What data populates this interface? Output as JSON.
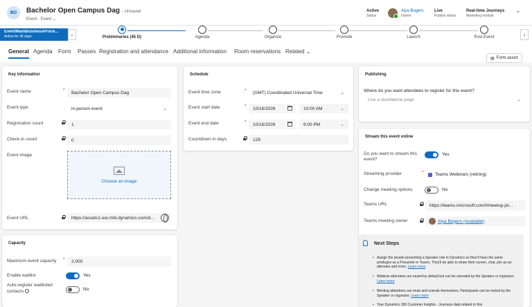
{
  "header": {
    "avatar_initials": "BO",
    "title": "Bachelor Open Campus Dag",
    "saved_state": "- Unsaved",
    "entity_type": "Event",
    "form_selector": "Event",
    "status_value": "Active",
    "status_label": "Status",
    "owner_value": "Alya Bogers",
    "owner_label": "Owner",
    "publish_value": "Live",
    "publish_label": "Publish status",
    "module_value": "Real-time Journeys",
    "module_label": "Marketing module"
  },
  "process": {
    "flag_title": "EventMainBusinessProce...",
    "flag_sub": "Active for 45 days",
    "stages": [
      {
        "label": "Preliminaries  (45 D)",
        "active": true
      },
      {
        "label": "Agenda",
        "active": false
      },
      {
        "label": "Organize",
        "active": false
      },
      {
        "label": "Promote",
        "active": false
      },
      {
        "label": "Launch",
        "active": false
      },
      {
        "label": "Post Event",
        "active": false
      }
    ]
  },
  "tabs": [
    "General",
    "Agenda",
    "Form",
    "Passes",
    "Registration and attendance",
    "Additional information",
    "Room reservations",
    "Related"
  ],
  "form_assist": "Form assist",
  "key_information": {
    "title": "Key information",
    "event_name_label": "Event name",
    "event_name_value": "Bachelor Open Campus Dag",
    "event_type_label": "Event type",
    "event_type_value": "in-person event",
    "registration_count_label": "Registration count",
    "registration_count_value": "1",
    "checkin_count_label": "Check-in count",
    "checkin_count_value": "0",
    "event_image_label": "Event image",
    "choose_image": "Choose an image",
    "event_url_label": "Event URL",
    "event_url_value": "https://assets1-eur.mkt.dynamics.com/d..."
  },
  "schedule": {
    "title": "Schedule",
    "timezone_label": "Event time zone",
    "timezone_value": "(GMT) Coordinated Universal Time",
    "start_label": "Event start date",
    "start_date": "10/16/2026",
    "start_time": "10:00 AM",
    "end_label": "Event end date",
    "end_date": "10/16/2026",
    "end_time": "6:00 PM",
    "countdown_label": "Countdown in days",
    "countdown_value": "129"
  },
  "publishing": {
    "title": "Publishing",
    "question": "Where do you want attendees to register for this event?",
    "placeholder": "Use a standalone page"
  },
  "stream": {
    "title": "Stream this event online",
    "stream_q": "Do you want to stream this event?",
    "stream_value": "Yes",
    "provider_label": "Streaming provider",
    "provider_value": "Teams Webinars (retiring)",
    "change_label": "Change meeting options",
    "change_value": "No",
    "teams_url_label": "Teams URL",
    "teams_url_value": "https://teams.microsoft.com/l/meetup-joi...",
    "owner_label": "Teams meeting owner",
    "owner_value": "Alya Bogers (Available)"
  },
  "next_steps": {
    "title": "Next Steps",
    "items": [
      {
        "text": "Assign the people presenting a Speaker role in Dynamics so they'll have the same privileges as a Presenter in Teams. They'll be able to share their screen, chat, join as an attendee and more.",
        "link": "Learn more"
      },
      {
        "text": "Webinar attendees are muted by default but can be unmuted by the Speaker or organizer.",
        "link": "Learn more"
      },
      {
        "text": "Meeting attendees can mute and unmute themselves. Participants can be muted by the Speaker or organizer.",
        "link": "Learn more"
      },
      {
        "text": "Your Dynamics 365 Customer Insights - Journeys data related to this",
        "link": ""
      }
    ]
  },
  "capacity": {
    "title": "Capacity",
    "max_label": "Maximum event capacity",
    "max_value": "2,000",
    "waitlist_label": "Enable waitlist",
    "waitlist_value": "Yes",
    "autoreg_label_1": "Auto-register waitlisted",
    "autoreg_label_2": "contacts",
    "autoreg_value": "No"
  }
}
